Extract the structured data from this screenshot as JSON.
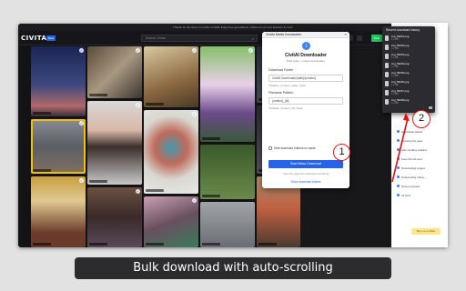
{
  "banner": "Thanks for the crazy 4 months of 2025. Enjoy free generations, check out our new features & more!",
  "topbar": {
    "logo": "CIVITAI",
    "badge": "Beta",
    "search_placeholder": "Search Civitai",
    "post_label": "Post"
  },
  "popup": {
    "window_title": "CivitAI Media Downloader",
    "app_name": "CivitAI Downloader",
    "subtitle": "Bulk video + image downloader",
    "folder_label": "Download Folder",
    "folder_value": "CivitAI Downloads/{date}/{creator}",
    "folder_hint": "Variables: {creator}, {date}, {type}",
    "filename_label": "Filename Pattern",
    "filename_value": "{creator}_{id}",
    "filename_hint": "Variables: {creator}, {id}, {date}",
    "hide_label": "Hide download buttons on cards",
    "start_label": "Start Mass Download",
    "note": "Scan the page and download everything",
    "link": "Show download folders",
    "callout": "1"
  },
  "downloads": {
    "title": "Recent download history",
    "files": [
      {
        "name": "img_56201.png",
        "size": "1.2 MB"
      },
      {
        "name": "img_56202.png",
        "size": "1.4 MB"
      },
      {
        "name": "img_56203.png",
        "size": "1.1 MB"
      },
      {
        "name": "img_56204.png",
        "size": "1.3 MB"
      },
      {
        "name": "img_56205.png",
        "size": "1.6 MB"
      },
      {
        "name": "img_56206.png",
        "size": "1.2 MB"
      },
      {
        "name": "img_56207.png",
        "size": "1.5 MB"
      },
      {
        "name": "img_56208.png",
        "size": "1.0 MB"
      }
    ]
  },
  "ext_panel": {
    "rows": [
      "Downloads started",
      "Scanning the page",
      "Auto scrolling enabled",
      "Keep this tab open",
      "Downloading images",
      "Downloading videos",
      "Queue progress",
      "All done"
    ],
    "badge": "Buy me a coffee",
    "callout": "2"
  },
  "caption": "Bulk download with auto-scrolling",
  "colors": {
    "accent": "#2563eb",
    "highlight": "#f2c200",
    "callout": "#e11111"
  }
}
